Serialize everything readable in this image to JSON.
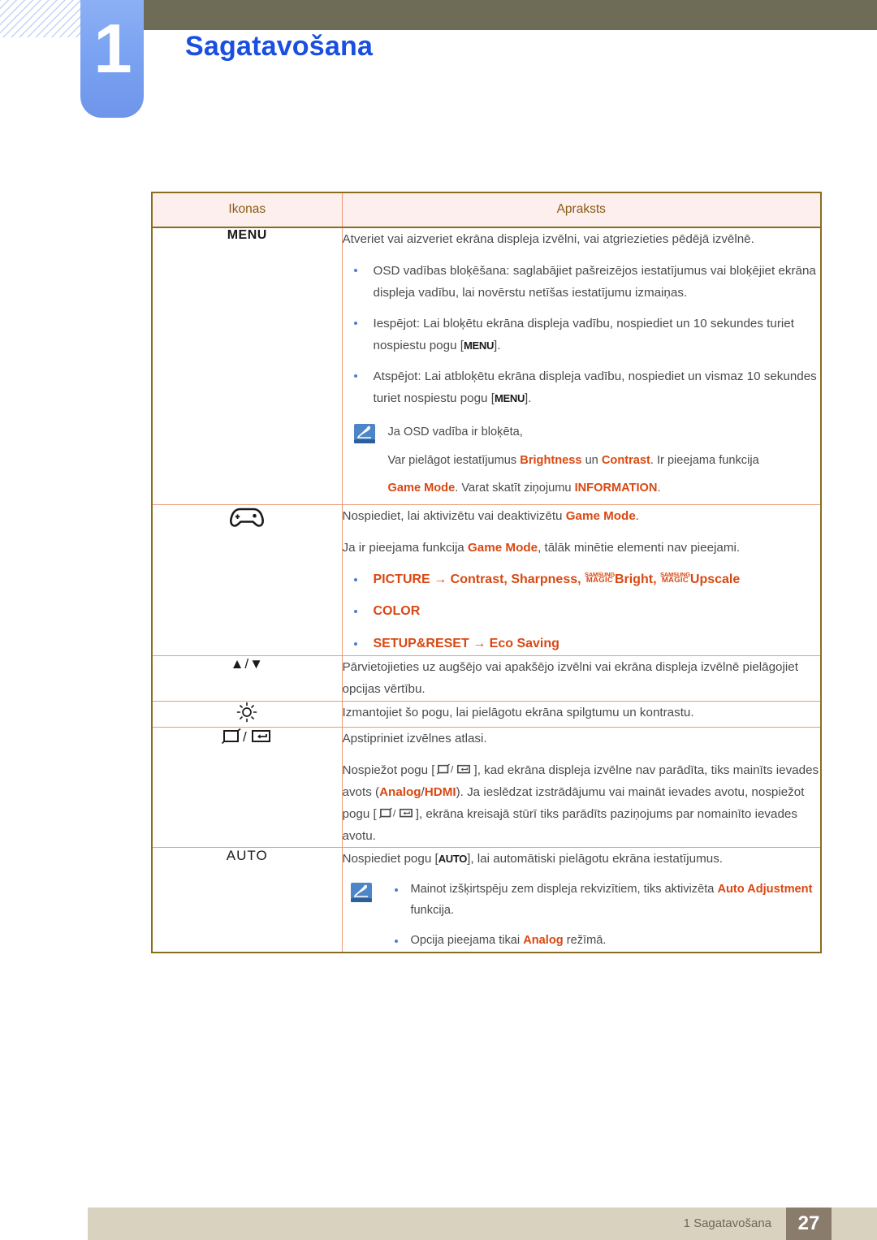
{
  "header": {
    "chapter_number": "1",
    "chapter_title": "Sagatavošana"
  },
  "table": {
    "columns": [
      "Ikonas",
      "Apraksts"
    ],
    "rows": [
      {
        "icon_label": "MENU",
        "icon_name": "menu-button-icon",
        "intro": "Atveriet vai aizveriet ekrāna displeja izvēlni, vai atgriezieties pēdējā izvēlnē.",
        "bullets": [
          "OSD vadības bloķēšana: saglabājiet pašreizējos iestatījumus vai bloķējiet ekrāna displeja vadību, lai novērstu netīšas iestatījumu izmaiņas.",
          "Iespējot: Lai bloķētu ekrāna displeja vadību, nospiediet un 10 sekundes turiet nospiestu pogu [MENU].",
          "Atspējot: Lai atbloķētu ekrāna displeja vadību, nospiediet un vismaz 10 sekundes turiet nospiestu pogu [MENU]."
        ],
        "bullet2_pre": "Iespējot: Lai bloķētu ekrāna displeja vadību, nospiediet un 10 sekundes turiet nospiestu pogu [",
        "bullet2_key": "MENU",
        "bullet2_post": "].",
        "bullet3_pre": "Atspējot: Lai atbloķētu ekrāna displeja vadību, nospiediet un vismaz 10 sekundes turiet nospiestu pogu [",
        "bullet3_key": "MENU",
        "bullet3_post": "].",
        "note_title": "Ja OSD vadība ir bloķēta,",
        "note_l1_a": "Var pielāgot iestatījumus ",
        "note_l1_b": "Brightness",
        "note_l1_c": " un ",
        "note_l1_d": "Contrast",
        "note_l1_e": ". Ir pieejama funkcija",
        "note_l2_a": "Game Mode",
        "note_l2_b": ". Varat skatīt ziņojumu ",
        "note_l2_c": "INFORMATION",
        "note_l2_d": "."
      },
      {
        "icon_name": "gamepad-icon",
        "line1_a": "Nospiediet, lai aktivizētu vai deaktivizētu ",
        "line1_b": "Game Mode",
        "line1_c": ".",
        "line2_a": "Ja ir pieejama funkcija ",
        "line2_b": "Game Mode",
        "line2_c": ", tālāk minētie elementi nav pieejami.",
        "b1_menu": "PICTURE",
        "b1_arrow": "→",
        "b1_items_pre": "Contrast, Sharpness, ",
        "b1_magic1_top": "SAMSUNG",
        "b1_magic1_bot": "MAGIC",
        "b1_word1": "Bright",
        "b1_sep": ", ",
        "b1_magic2_top": "SAMSUNG",
        "b1_magic2_bot": "MAGIC",
        "b1_word2": "Upscale",
        "b2": "COLOR",
        "b3_menu": "SETUP&RESET",
        "b3_arrow": "→",
        "b3_item": "Eco Saving"
      },
      {
        "icon_label": "▲/▼",
        "icon_name": "up-down-arrows-icon",
        "text": "Pārvietojieties uz augšējo vai apakšējo izvēlni vai ekrāna displeja izvēlnē pielāgojiet opcijas vērtību."
      },
      {
        "icon_name": "brightness-sun-icon",
        "text": "Izmantojiet šo pogu, lai pielāgotu ekrāna spilgtumu un kontrastu."
      },
      {
        "icon_name": "source-enter-icon",
        "line1": "Apstipriniet izvēlnes atlasi.",
        "p2_a": "Nospiežot pogu [",
        "p2_b": "], kad ekrāna displeja izvēlne nav parādīta, tiks mainīts ievades avots (",
        "p2_c": "Analog",
        "p2_d": "/",
        "p2_e": "HDMI",
        "p2_f": "). Ja ieslēdzat izstrādājumu vai maināt ievades avotu, nospiežot pogu [",
        "p2_g": "], ekrāna kreisajā stūrī tiks parādīts paziņojums par nomainīto ievades avotu."
      },
      {
        "icon_label": "AUTO",
        "icon_name": "auto-button-icon",
        "line1_a": "Nospiediet pogu [",
        "line1_key": "AUTO",
        "line1_b": "], lai automātiski pielāgotu ekrāna iestatījumus.",
        "n1_a": "Mainot izšķirtspēju zem displeja rekvizītiem, tiks aktivizēta ",
        "n1_b": "Auto Adjustment",
        "n1_c": " funkcija.",
        "n2_a": "Opcija pieejama tikai ",
        "n2_b": "Analog",
        "n2_c": " režīmā."
      }
    ]
  },
  "footer": {
    "label": "1 Sagatavošana",
    "page": "27"
  },
  "colors": {
    "accent_orange": "#d94812",
    "title_blue": "#1a4fe0",
    "header_olive": "#6e6b56",
    "table_border": "#8a6d1c",
    "table_inner_border": "#ea9a78",
    "header_cell_bg": "#fcefee",
    "footer_bar": "#d8d2bf",
    "footer_page_bg": "#8a7c6d"
  }
}
